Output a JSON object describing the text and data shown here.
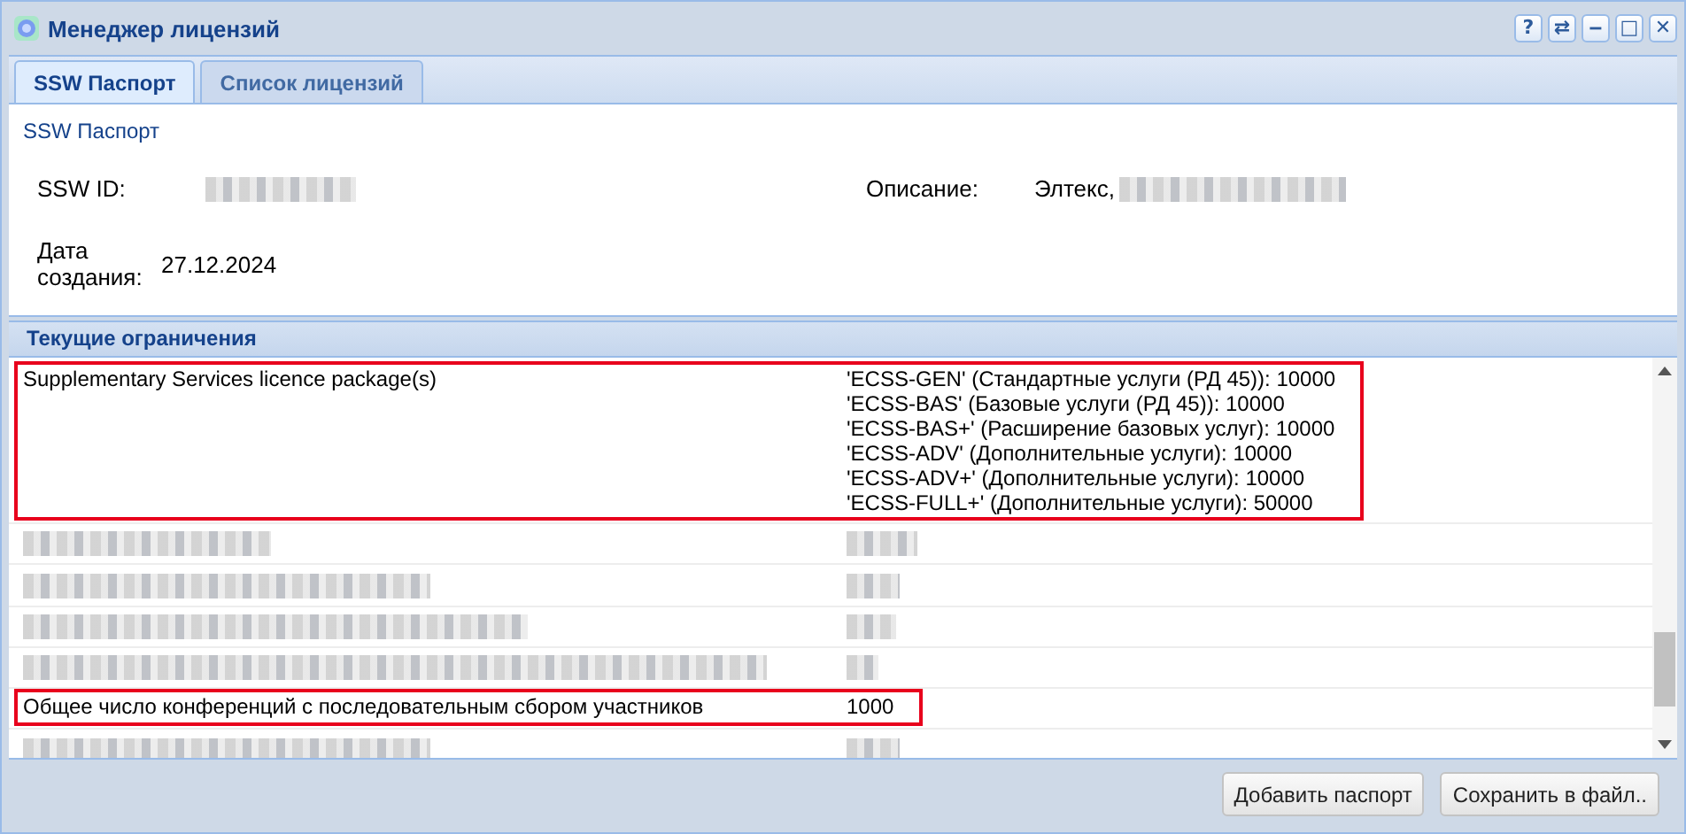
{
  "window": {
    "title": "Менеджер лицензий",
    "controls": [
      "?",
      "⇄",
      "‒",
      "□",
      "✕"
    ]
  },
  "tabs": [
    {
      "label": "SSW Паспорт",
      "selected": true
    },
    {
      "label": "Список лицензий",
      "selected": false
    }
  ],
  "passport": {
    "heading": "SSW Паспорт",
    "fields": [
      {
        "label": "SSW ID:",
        "redacted": true
      },
      {
        "label": "Описание:",
        "value": "Элтекс,",
        "redacted": true
      },
      {
        "label": "Дата создания:",
        "value": "27.12.2024",
        "redacted": false
      }
    ]
  },
  "limits": {
    "title": "Текущие ограничения",
    "rows": [
      {
        "kind": "text",
        "highlighted": true,
        "name": "Supplementary Services licence package(s)",
        "values": [
          "'ECSS-GEN' (Стандартные услуги (РД 45)): 10000",
          "'ECSS-BAS' (Базовые услуги (РД 45)): 10000",
          "'ECSS-BAS+' (Расширение базовых услуг): 10000",
          "'ECSS-ADV' (Дополнительные услуги): 10000",
          "'ECSS-ADV+' (Дополнительные услуги): 10000",
          "'ECSS-FULL+' (Дополнительные услуги): 50000"
        ]
      },
      {
        "kind": "redacted",
        "highlighted": false
      },
      {
        "kind": "redacted",
        "highlighted": false
      },
      {
        "kind": "redacted",
        "highlighted": false
      },
      {
        "kind": "redacted",
        "highlighted": false
      },
      {
        "kind": "text",
        "highlighted": true,
        "name": "Общее число конференций с последовательным сбором участников",
        "values": [
          "1000"
        ]
      },
      {
        "kind": "redacted",
        "highlighted": false
      }
    ]
  },
  "buttons": [
    "Добавить паспорт",
    "Сохранить в файл.."
  ]
}
